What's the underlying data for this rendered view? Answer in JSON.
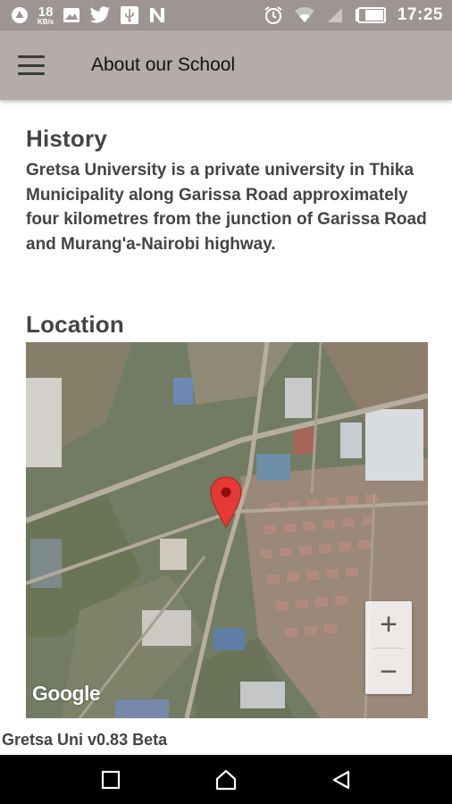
{
  "status_bar": {
    "net_speed_value": "18",
    "net_speed_unit": "KB/s",
    "time": "17:25",
    "left_icons": [
      "app-notification-icon",
      "image-icon",
      "twitter-icon",
      "usb-icon",
      "n-notification-icon"
    ],
    "right_icons": [
      "alarm-icon",
      "wifi-icon",
      "signal-icon",
      "battery-icon"
    ]
  },
  "app_bar": {
    "title": "About our School",
    "menu_icon": "hamburger-menu-icon"
  },
  "history": {
    "heading": "History",
    "text": "Gretsa University is a private university in Thika Municipality along Garissa Road approximately four kilometres from the junction of Garissa Road and Murang'a-Nairobi highway."
  },
  "location": {
    "heading": "Location",
    "zoom_in": "+",
    "zoom_out": "−",
    "attribution": "Google"
  },
  "footer": {
    "version": "Gretsa Uni v0.83 Beta"
  },
  "nav_bar": {
    "buttons": [
      "recent-apps-icon",
      "home-icon",
      "back-icon"
    ]
  },
  "colors": {
    "status_bar": "#9f9494",
    "app_bar": "#b5abab",
    "text": "#444444",
    "pin": "#e53935"
  }
}
